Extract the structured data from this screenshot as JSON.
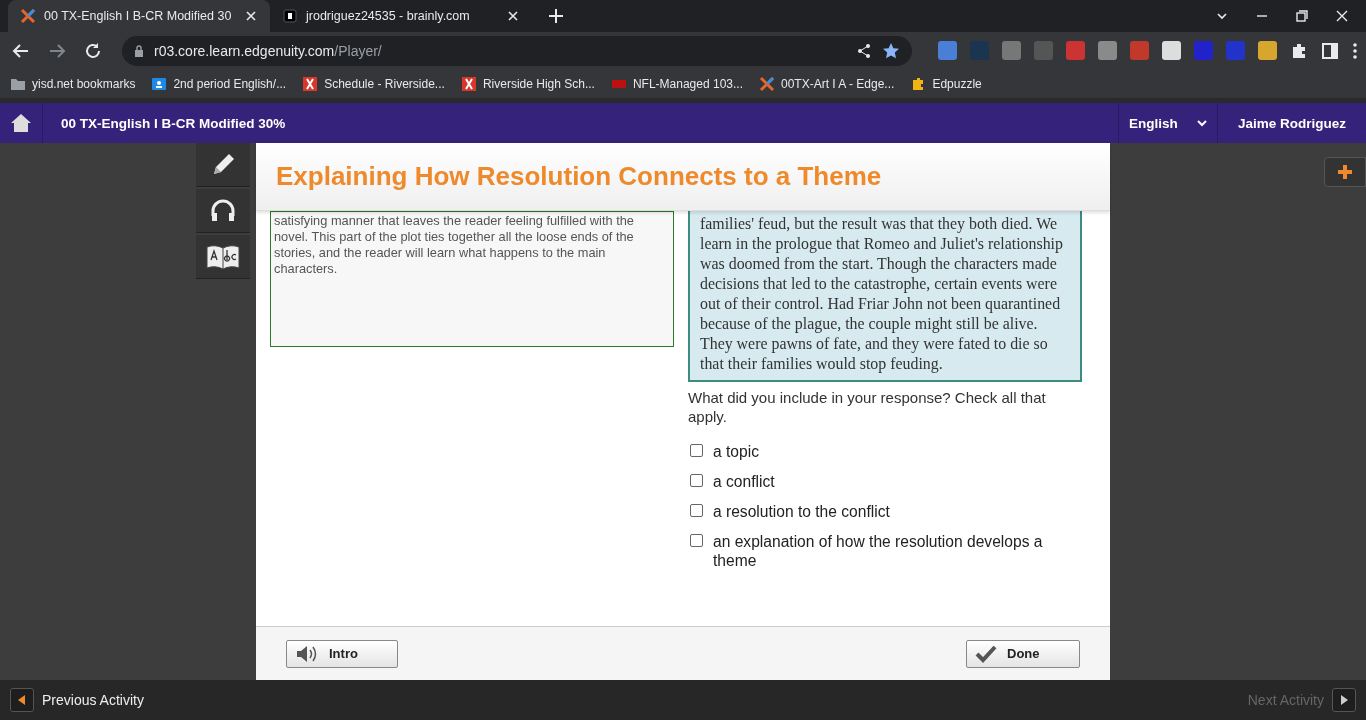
{
  "browser": {
    "tabs": [
      {
        "title": "00 TX-English I B-CR Modified 30",
        "selected": true,
        "kind": "edge"
      },
      {
        "title": "jrodriguez24535 - brainly.com",
        "selected": false,
        "kind": "brainly"
      }
    ],
    "address": {
      "host": "r03.core.learn.edgenuity.com",
      "path": "/Player/"
    },
    "bookmarks": [
      {
        "label": "yisd.net bookmarks",
        "kind": "folder"
      },
      {
        "label": "2nd period English/...",
        "kind": "classroom"
      },
      {
        "label": "Schedule - Riverside...",
        "kind": "x"
      },
      {
        "label": "Riverside High Sch...",
        "kind": "x"
      },
      {
        "label": "NFL-Managed 103...",
        "kind": "nfl"
      },
      {
        "label": "00TX-Art I A - Edge...",
        "kind": "edge"
      },
      {
        "label": "Edpuzzle",
        "kind": "puzzle"
      }
    ]
  },
  "app_bar": {
    "course_title": "00 TX-English I B-CR Modified 30%",
    "language": "English",
    "user": "Jaime Rodriguez"
  },
  "lesson": {
    "title": "Explaining How Resolution Connects to a Theme",
    "response": "satisfying manner that leaves the reader feeling fulfilled with the novel. This part of the plot ties together all the loose ends of the stories, and the reader will learn what happens to the main characters.",
    "sample": "families' feud, but the result was that they both died. We learn in the prologue that Romeo and Juliet's relationship was doomed from the start. Though the characters made decisions that led to the catastrophe, certain events were out of their control. Had Friar John not been quarantined because of the plague, the couple might still be alive. They were pawns of fate, and they were fated to die so that their families would stop feuding.",
    "question": "What did you include in your response? Check all that apply.",
    "options": [
      {
        "label": "a topic",
        "checked": false
      },
      {
        "label": "a conflict",
        "checked": false
      },
      {
        "label": "a resolution to the conflict",
        "checked": false
      },
      {
        "label": "an explanation of how the resolution develops a theme",
        "checked": false
      }
    ],
    "buttons": {
      "intro": "Intro",
      "done": "Done"
    }
  },
  "nav": {
    "previous": {
      "label": "Previous Activity",
      "disabled": false
    },
    "next": {
      "label": "Next Activity",
      "disabled": true
    }
  }
}
